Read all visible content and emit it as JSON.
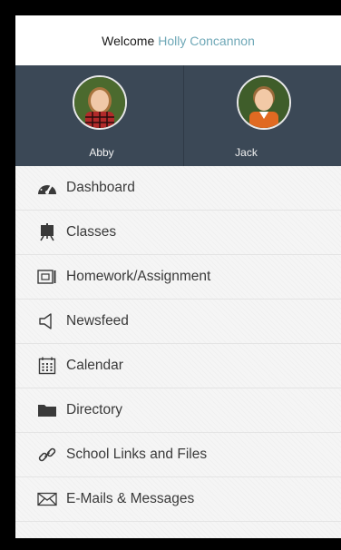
{
  "header": {
    "welcome": "Welcome",
    "user_name": "Holly Concannon"
  },
  "kids": [
    {
      "name": "Abby"
    },
    {
      "name": "Jack"
    }
  ],
  "menu": [
    {
      "label": "Dashboard",
      "icon": "speedometer-icon"
    },
    {
      "label": "Classes",
      "icon": "presentation-board-icon"
    },
    {
      "label": "Homework/Assignment",
      "icon": "homework-icon"
    },
    {
      "label": "Newsfeed",
      "icon": "speaker-icon"
    },
    {
      "label": "Calendar",
      "icon": "calendar-icon"
    },
    {
      "label": "Directory",
      "icon": "folder-icon"
    },
    {
      "label": "School Links and Files",
      "icon": "link-icon"
    },
    {
      "label": "E-Mails & Messages",
      "icon": "envelope-icon"
    }
  ],
  "colors": {
    "accent": "#6fa8b7",
    "kids_bar": "#3b4856",
    "menu_bg": "#f5f5f5"
  }
}
